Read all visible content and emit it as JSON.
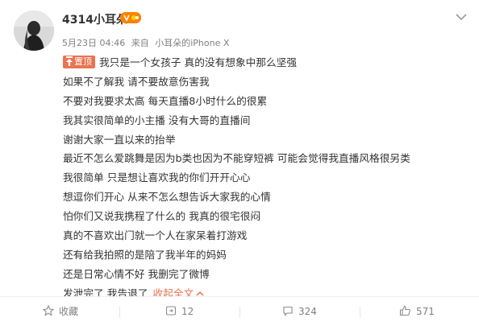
{
  "author": {
    "name": "4314小耳朵",
    "badge": "vip",
    "date": "5月23日 04:46",
    "source_prefix": "来自",
    "source": "小耳朵的iPhone X"
  },
  "pin_label": "置顶",
  "lines": [
    "我只是一个女孩子 真的没有想象中那么坚强",
    "如果不了解我 请不要故意伤害我",
    "不要对我要求太高 每天直播8小时什么的很累",
    "我其实很简单的小主播 没有大哥的直播间",
    "谢谢大家一直以来的抬举",
    "最近不怎么爱跳舞是因为b类也因为不能穿短裤 可能会觉得我直播风格很另类",
    "我很简单 只是想让喜欢我的你们开开心心",
    "想逗你们开心 从来不怎么想告诉大家我的心情",
    "怕你们又说我携程了什么的 我真的很宅很闷",
    "真的不喜欢出门就一个人在家呆着打游戏",
    "还有给我拍照的是陪了我半年的妈妈",
    "还是日常心情不好 我删完了微博"
  ],
  "last_line": "发泄完了 我告退了",
  "collapse_label": "收起全文",
  "toolbar": {
    "favorite_label": "收藏",
    "repost_count": "12",
    "comment_count": "324",
    "like_count": "571"
  },
  "colors": {
    "accent": "#eb7350",
    "muted": "#808080",
    "text": "#333333"
  }
}
